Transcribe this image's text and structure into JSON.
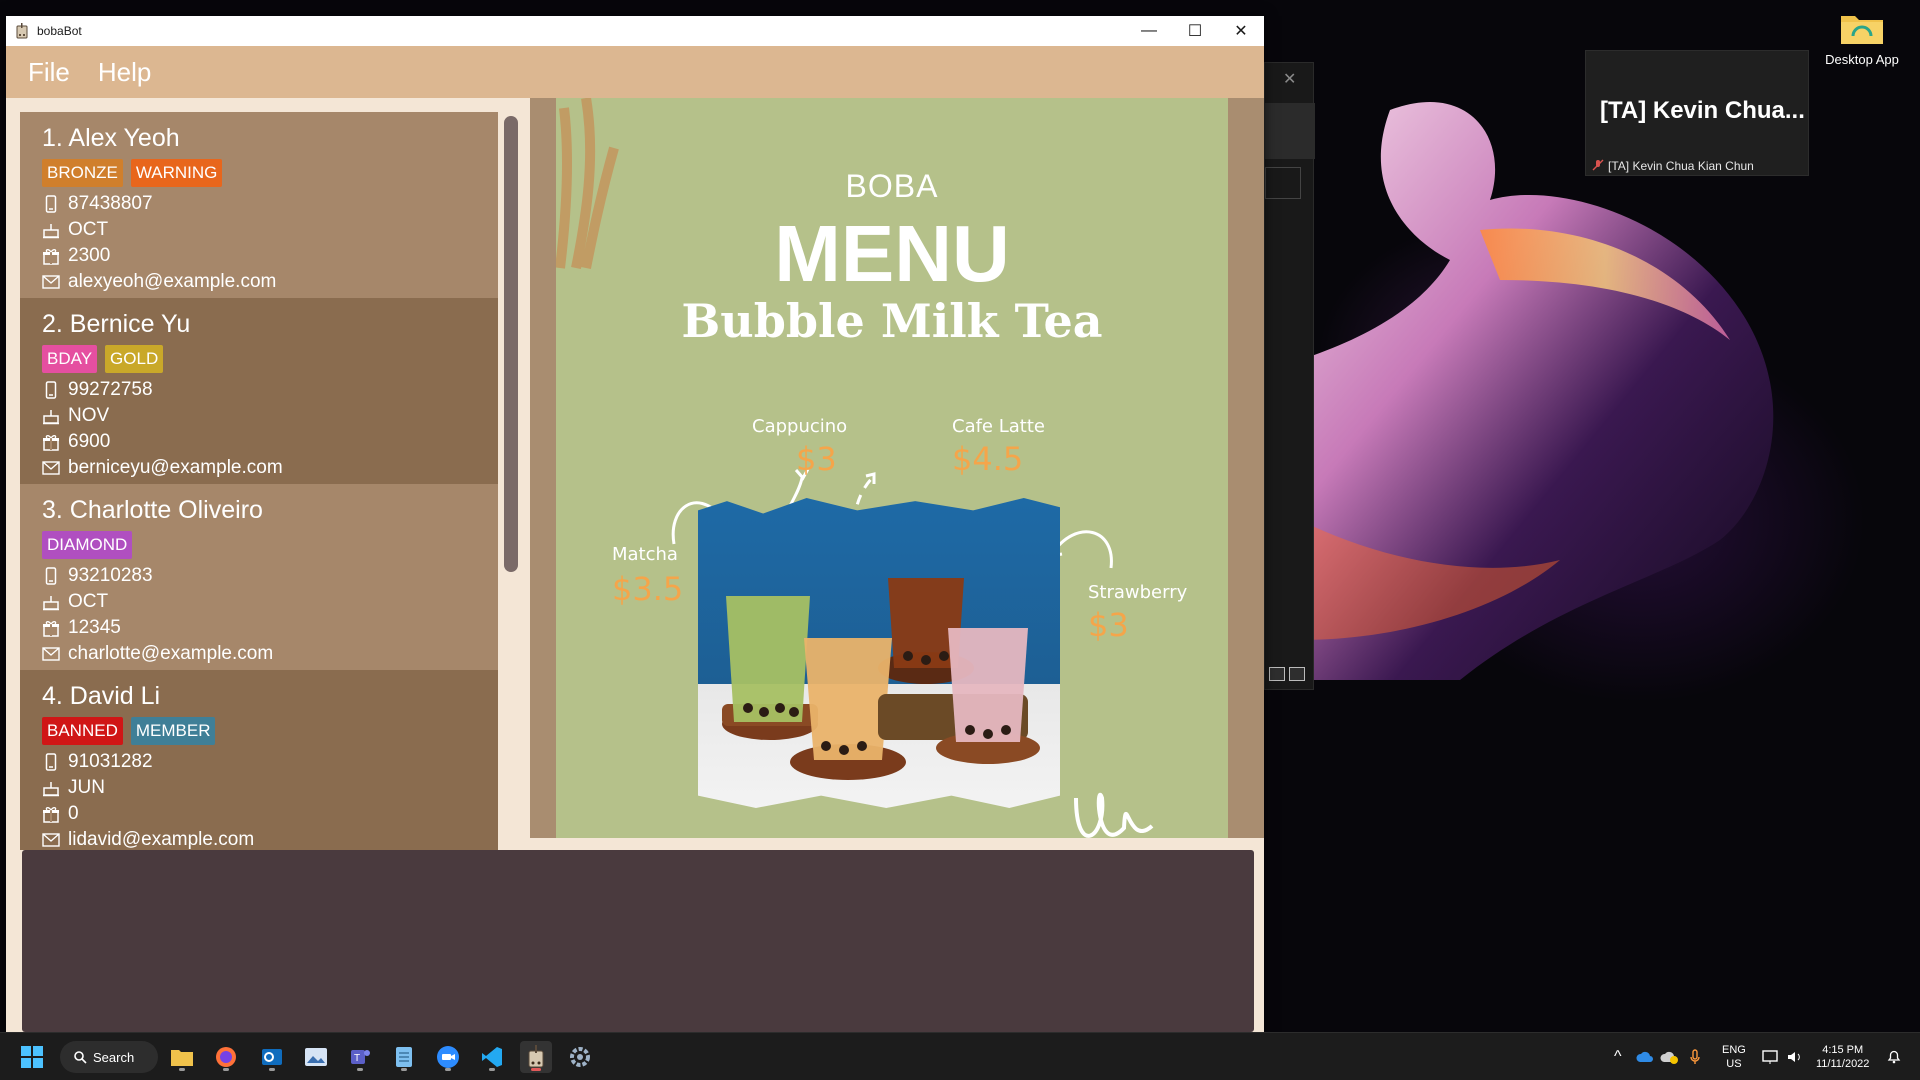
{
  "desktop": {
    "icon_label": "Desktop App",
    "teams_tile": {
      "title": "[TA] Kevin Chua...",
      "participant": "[TA] Kevin Chua Kian Chun"
    }
  },
  "window": {
    "title": "bobaBot",
    "controls": {
      "minimize": "—",
      "maximize": "☐",
      "close": "✕"
    }
  },
  "menubar": {
    "file": "File",
    "help": "Help"
  },
  "customers": [
    {
      "index": "1.",
      "name": "Alex Yeoh",
      "tags": [
        {
          "label": "BRONZE",
          "color": "#d07f2c"
        },
        {
          "label": "WARNING",
          "color": "#e8661c"
        }
      ],
      "phone": "87438807",
      "birthday": "OCT",
      "reward": "2300",
      "email": "alexyeoh@example.com"
    },
    {
      "index": "2.",
      "name": "Bernice Yu",
      "tags": [
        {
          "label": "BDAY",
          "color": "#e54fa0"
        },
        {
          "label": "GOLD",
          "color": "#c9a829"
        }
      ],
      "phone": "99272758",
      "birthday": "NOV",
      "reward": "6900",
      "email": "berniceyu@example.com"
    },
    {
      "index": "3.",
      "name": "Charlotte Oliveiro",
      "tags": [
        {
          "label": "DIAMOND",
          "color": "#b04fc0"
        }
      ],
      "phone": "93210283",
      "birthday": "OCT",
      "reward": "12345",
      "email": "charlotte@example.com"
    },
    {
      "index": "4.",
      "name": "David Li",
      "tags": [
        {
          "label": "BANNED",
          "color": "#d01616"
        },
        {
          "label": "MEMBER",
          "color": "#3f7f97"
        }
      ],
      "phone": "91031282",
      "birthday": "JUN",
      "reward": "0",
      "email": "lidavid@example.com"
    }
  ],
  "menu_image": {
    "brand": "BOBA",
    "heading": "MENU",
    "subtitle": "Bubble Milk Tea",
    "items": [
      {
        "name": "Cappucino",
        "price": "$3"
      },
      {
        "name": "Cafe Latte",
        "price": "$4.5"
      },
      {
        "name": "Matcha",
        "price": "$3.5"
      },
      {
        "name": "Strawberry",
        "price": "$3"
      }
    ]
  },
  "taskbar": {
    "search_label": "Search",
    "language": "ENG",
    "region": "US",
    "time": "4:15 PM",
    "date": "11/11/2022"
  }
}
